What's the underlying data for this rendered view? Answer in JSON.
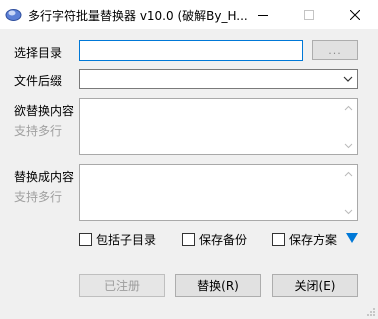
{
  "window": {
    "title": "多行字符批量替换器 v10.0 (破解By_H...",
    "app_icon": "cloud-icon",
    "controls": [
      "minimize-icon",
      "maximize-icon",
      "close-icon"
    ]
  },
  "form": {
    "dir_label": "选择目录",
    "dir_value": "",
    "browse_label": "...",
    "ext_label": "文件后缀",
    "ext_value": "",
    "find_label": "欲替换内容",
    "find_hint": "支持多行",
    "find_value": "",
    "replace_label": "替换成内容",
    "replace_hint": "支持多行",
    "replace_value": ""
  },
  "options": {
    "include_subdirs": "包括子目录",
    "save_backup": "保存备份",
    "save_scheme": "保存方案",
    "expand_icon": "triangle-down-icon",
    "accent": "#0078d7"
  },
  "buttons": {
    "registered": "已注册",
    "replace": "替换(R)",
    "close": "关闭(E)"
  }
}
